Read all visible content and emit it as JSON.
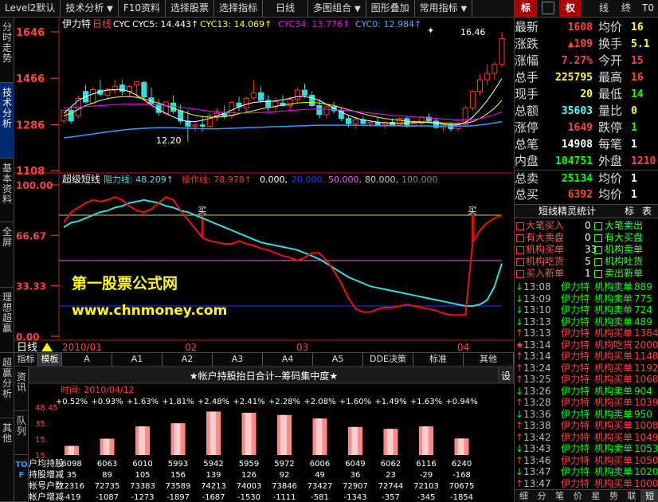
{
  "topbar": {
    "menu": [
      "Level2默认",
      "技术分析",
      "F10资料",
      "选择股票",
      "选择指标",
      "日线",
      "多图组合",
      "图形叠加",
      "常用指标"
    ]
  },
  "side_tabs": [
    "分时走势",
    "技术分析",
    "基本资料",
    "全屏",
    "理想超赢",
    "超赢分析",
    "资讯",
    "队列",
    "其他"
  ],
  "chart": {
    "stock": "伊力特",
    "period": "日线",
    "ind": "CYC",
    "legend": [
      {
        "label": "CYC5: 14.443↑",
        "color": "#ffffff"
      },
      {
        "label": "CYC13: 14.069↑",
        "color": "#ffff00"
      },
      {
        "label": "CYC34: 13.776↑",
        "color": "#ff00ff"
      },
      {
        "label": "CYC0: 12.984↑",
        "color": "#55aaff"
      }
    ],
    "price_ticks": [
      "1646",
      "1466",
      "1286",
      "1108"
    ],
    "price_ticks_val": [
      16.46,
      14.66,
      12.86,
      11.08
    ],
    "high_label": "16.46",
    "low_label": "12.20",
    "sub": {
      "name": "超级短线",
      "legend": [
        {
          "label": "阻力线: 48.209↑",
          "color": "#55dddd"
        },
        {
          "label": "操作线: 78.978↑",
          "color": "#ff3333"
        },
        {
          "label": "0.000,",
          "color": "#ffffff"
        },
        {
          "label": "20.000,",
          "color": "#3333ff"
        },
        {
          "label": "50.000,",
          "color": "#ff55ff"
        },
        {
          "label": "80.000,",
          "color": "#cccccc"
        },
        {
          "label": "100.000",
          "color": "#888888"
        }
      ],
      "ticks": [
        "100.00",
        "66.67",
        "33.33",
        "0.00"
      ],
      "ticks_val": [
        100,
        66.67,
        33.33,
        0
      ],
      "buy": "买"
    },
    "period_label": "日线",
    "dates": [
      "2010/01",
      "02",
      "03",
      "04"
    ],
    "watermark1": "第一股票公式网",
    "watermark2": "www.chnmoney.com",
    "candles": [
      [
        13.0,
        13.42,
        12.94,
        13.42
      ],
      [
        13.42,
        13.55,
        12.9,
        13.0
      ],
      [
        13.2,
        14.0,
        13.1,
        13.88
      ],
      [
        14.15,
        14.4,
        13.7,
        13.74
      ],
      [
        13.7,
        14.3,
        13.66,
        14.22
      ],
      [
        14.2,
        14.6,
        13.95,
        14.04
      ],
      [
        14.0,
        14.3,
        13.85,
        14.23
      ],
      [
        14.2,
        14.6,
        14.05,
        14.35
      ],
      [
        14.4,
        14.6,
        14.0,
        14.15
      ],
      [
        14.15,
        14.4,
        13.9,
        14.34
      ],
      [
        14.4,
        14.55,
        13.9,
        14.52
      ],
      [
        14.5,
        14.55,
        13.8,
        13.93
      ],
      [
        13.9,
        14.3,
        13.6,
        13.68
      ],
      [
        13.65,
        13.85,
        13.2,
        13.33
      ],
      [
        13.3,
        13.75,
        13.2,
        13.74
      ],
      [
        13.7,
        14.0,
        13.3,
        13.38
      ],
      [
        13.4,
        13.65,
        12.9,
        13.0
      ],
      [
        13.0,
        13.4,
        12.2,
        12.8
      ],
      [
        12.8,
        13.0,
        12.6,
        12.85
      ],
      [
        12.85,
        13.2,
        12.6,
        12.8
      ],
      [
        12.8,
        13.3,
        12.75,
        13.2
      ],
      [
        13.2,
        13.5,
        13.0,
        13.3
      ],
      [
        13.3,
        13.6,
        13.1,
        13.17
      ],
      [
        13.2,
        13.8,
        13.1,
        13.72
      ],
      [
        13.7,
        13.95,
        13.4,
        13.55
      ],
      [
        13.5,
        13.95,
        13.3,
        13.88
      ],
      [
        13.9,
        14.6,
        13.8,
        14.1
      ],
      [
        14.1,
        14.35,
        13.7,
        13.8
      ],
      [
        13.8,
        14.0,
        13.4,
        13.55
      ],
      [
        13.55,
        13.9,
        13.3,
        13.75
      ],
      [
        13.7,
        14.0,
        13.55,
        13.6
      ],
      [
        13.6,
        13.95,
        13.4,
        13.85
      ],
      [
        13.85,
        14.3,
        13.7,
        14.2
      ],
      [
        14.2,
        14.45,
        13.9,
        14.0
      ],
      [
        14.0,
        14.15,
        13.55,
        13.6
      ],
      [
        13.6,
        13.85,
        13.1,
        13.25
      ],
      [
        13.25,
        13.65,
        13.1,
        13.55
      ],
      [
        13.55,
        13.75,
        13.3,
        13.4
      ],
      [
        13.4,
        13.5,
        13.0,
        13.1
      ],
      [
        13.1,
        13.2,
        12.75,
        12.9
      ],
      [
        12.9,
        13.15,
        12.7,
        13.05
      ],
      [
        13.05,
        13.2,
        12.85,
        12.9
      ],
      [
        12.9,
        13.05,
        12.75,
        12.95
      ],
      [
        12.95,
        13.15,
        12.8,
        12.85
      ],
      [
        12.85,
        13.0,
        12.7,
        12.95
      ],
      [
        12.95,
        13.1,
        12.8,
        12.85
      ],
      [
        12.85,
        13.15,
        12.8,
        13.1
      ],
      [
        13.1,
        13.2,
        12.75,
        12.8
      ],
      [
        12.8,
        13.05,
        12.75,
        12.9
      ],
      [
        12.9,
        13.2,
        12.8,
        13.15
      ],
      [
        13.15,
        13.3,
        12.9,
        13.0
      ],
      [
        13.0,
        13.1,
        12.7,
        12.75
      ],
      [
        12.75,
        12.9,
        12.6,
        12.85
      ],
      [
        12.85,
        12.95,
        12.6,
        12.7
      ],
      [
        12.7,
        12.95,
        12.6,
        12.9
      ],
      [
        12.85,
        13.6,
        12.8,
        13.5
      ],
      [
        13.5,
        14.2,
        13.4,
        14.15
      ],
      [
        14.15,
        14.8,
        14.0,
        14.6
      ],
      [
        14.6,
        15.2,
        14.4,
        14.85
      ],
      [
        14.85,
        15.3,
        14.6,
        15.2
      ],
      [
        15.2,
        16.46,
        15.1,
        16.2
      ]
    ],
    "ma": {
      "cyc5": [
        13.3,
        13.55,
        13.8,
        13.95,
        14.05,
        14.15,
        14.2,
        14.22,
        14.22,
        14.15,
        14.0,
        13.82,
        13.62,
        13.45,
        13.3,
        13.16,
        13.05,
        12.98,
        12.98,
        13.03,
        13.1,
        13.2,
        13.3,
        13.42,
        13.55,
        13.65,
        13.72,
        13.75,
        13.76,
        13.78,
        13.82,
        13.88,
        13.95,
        13.95,
        13.9,
        13.8,
        13.65,
        13.5,
        13.35,
        13.22,
        13.12,
        13.05,
        13.0,
        12.96,
        12.93,
        12.92,
        12.92,
        12.93,
        12.94,
        12.95,
        12.94,
        12.92,
        12.88,
        12.85,
        12.85,
        12.95,
        13.15,
        13.45,
        13.8,
        14.2,
        14.65
      ],
      "cyc13": [
        13.2,
        13.3,
        13.45,
        13.6,
        13.7,
        13.8,
        13.87,
        13.92,
        13.95,
        13.95,
        13.92,
        13.86,
        13.78,
        13.7,
        13.6,
        13.5,
        13.4,
        13.3,
        13.22,
        13.17,
        13.15,
        13.15,
        13.18,
        13.22,
        13.28,
        13.34,
        13.4,
        13.47,
        13.52,
        13.57,
        13.62,
        13.66,
        13.7,
        13.72,
        13.72,
        13.7,
        13.65,
        13.6,
        13.52,
        13.44,
        13.36,
        13.28,
        13.21,
        13.15,
        13.1,
        13.06,
        13.03,
        13.0,
        12.98,
        12.97,
        12.96,
        12.95,
        12.93,
        12.92,
        12.9,
        12.92,
        12.98,
        13.1,
        13.28,
        13.5,
        13.8
      ],
      "cyc34": [
        13.5,
        13.52,
        13.54,
        13.56,
        13.58,
        13.6,
        13.62,
        13.64,
        13.65,
        13.66,
        13.66,
        13.66,
        13.65,
        13.63,
        13.6,
        13.57,
        13.54,
        13.5,
        13.46,
        13.42,
        13.38,
        13.35,
        13.33,
        13.32,
        13.31,
        13.31,
        13.32,
        13.33,
        13.35,
        13.37,
        13.39,
        13.41,
        13.43,
        13.45,
        13.46,
        13.46,
        13.45,
        13.44,
        13.42,
        13.4,
        13.37,
        13.34,
        13.31,
        13.28,
        13.25,
        13.22,
        13.2,
        13.18,
        13.16,
        13.14,
        13.12,
        13.1,
        13.08,
        13.06,
        13.04,
        13.04,
        13.06,
        13.1,
        13.16,
        13.25,
        13.35
      ],
      "cyc0": [
        12.35,
        12.38,
        12.42,
        12.46,
        12.5,
        12.54,
        12.58,
        12.62,
        12.65,
        12.68,
        12.7,
        12.72,
        12.73,
        12.74,
        12.74,
        12.74,
        12.73,
        12.72,
        12.71,
        12.7,
        12.7,
        12.7,
        12.71,
        12.72,
        12.73,
        12.74,
        12.75,
        12.76,
        12.77,
        12.78,
        12.79,
        12.8,
        12.81,
        12.82,
        12.83,
        12.84,
        12.84,
        12.84,
        12.84,
        12.84,
        12.84,
        12.83,
        12.83,
        12.82,
        12.82,
        12.82,
        12.82,
        12.81,
        12.81,
        12.81,
        12.81,
        12.8,
        12.8,
        12.8,
        12.8,
        12.8,
        12.82,
        12.85,
        12.88,
        12.93,
        12.98
      ]
    },
    "op": [
      75,
      82,
      85,
      88,
      90,
      89,
      90,
      92,
      90,
      86,
      83,
      82,
      84,
      88,
      92,
      90,
      83,
      77,
      71,
      65,
      63,
      62,
      61,
      61,
      63,
      61,
      60,
      58,
      57,
      55,
      53,
      52,
      50,
      52,
      55,
      55,
      50,
      43,
      35,
      25,
      18,
      16,
      16,
      18,
      19,
      19,
      20,
      21,
      20,
      19,
      18,
      17,
      15,
      14,
      14,
      14,
      62,
      70,
      75,
      78,
      80
    ],
    "resist": [
      72,
      75,
      76,
      78,
      80,
      82,
      83,
      85,
      86,
      88,
      89,
      90,
      89,
      88,
      86,
      85,
      83,
      82,
      80,
      78,
      76,
      74,
      72,
      70,
      68,
      66,
      64,
      62,
      61,
      60,
      59,
      58,
      57,
      55,
      53,
      51,
      48,
      45,
      42,
      39,
      37,
      35,
      33,
      32,
      31,
      30,
      29,
      28,
      27,
      26,
      25,
      24,
      23,
      22,
      21,
      20,
      20,
      21,
      24,
      33,
      48
    ],
    "buy_idx": [
      19,
      56
    ]
  },
  "indicator_tabs": [
    "指标",
    "模板",
    "A",
    "A1",
    "A2",
    "A3",
    "A4",
    "A5",
    "DDE决策",
    "标准",
    "其他"
  ],
  "bottom": {
    "title": "★帐户持股抬日合计--筹码集中度★",
    "gear": "设",
    "date": "时间: 2010/04/12",
    "ticks": [
      "48.45",
      "35.",
      "15.",
      "15."
    ],
    "pct": [
      "+0.52%",
      "+0.93%",
      "+1.63%",
      "+1.81%",
      "+2.48%",
      "+2.41%",
      "+2.28%",
      "+2.08%",
      "+1.60%",
      "+1.49%",
      "+1.63%",
      "+0.94%"
    ],
    "pct_val": [
      0.52,
      0.93,
      1.63,
      1.81,
      2.48,
      2.41,
      2.28,
      2.08,
      1.6,
      1.49,
      1.63,
      0.94
    ],
    "rows": [
      {
        "label": "户均持股",
        "values": [
          "6098",
          "6063",
          "6010",
          "5993",
          "5942",
          "5959",
          "5972",
          "6006",
          "6049",
          "6062",
          "6116",
          "6240"
        ]
      },
      {
        "label": "持股增减",
        "values": [
          "35",
          "89",
          "105",
          "156",
          "139",
          "126",
          "92",
          "49",
          "36",
          "23",
          "-29",
          "-168"
        ]
      },
      {
        "label": "帐号户数",
        "values": [
          "72316",
          "72735",
          "73383",
          "73589",
          "74213",
          "74003",
          "73846",
          "73427",
          "72907",
          "72744",
          "72103",
          "70675"
        ]
      },
      {
        "label": "帐户增减",
        "values": [
          "-419",
          "-1087",
          "-1273",
          "-1897",
          "-1687",
          "-1530",
          "-1111",
          "-581",
          "-1343",
          "-357",
          "-345",
          "-1854"
        ]
      }
    ],
    "tof": "TOF"
  },
  "right": {
    "tabs": [
      "标",
      "权",
      "线",
      "终",
      "T0"
    ],
    "active_tab": "权",
    "quotes": [
      {
        "l1": "最新",
        "v1": "1608",
        "c1": "#ff4040",
        "l2": "均价",
        "v2": "16",
        "c2": "#ffff00"
      },
      {
        "l1": "涨跌",
        "v1": "▲109",
        "c1": "#ff4040",
        "l2": "换手",
        "v2": "5.1",
        "c2": "#ffff00"
      },
      {
        "l1": "涨幅",
        "v1": "7.27%",
        "c1": "#ff4040",
        "l2": "今开",
        "v2": "15",
        "c2": "#ff4040"
      },
      {
        "l1": "总手",
        "v1": "225795",
        "c1": "#ffff00",
        "l2": "最高",
        "v2": "16",
        "c2": "#ff4040"
      },
      {
        "l1": "现手",
        "v1": "20",
        "c1": "#ffff00",
        "l2": "最低",
        "v2": "14",
        "c2": "#00ff00"
      },
      {
        "l1": "总额",
        "v1": "35603",
        "c1": "#55ffff",
        "l2": "量比",
        "v2": "0",
        "c2": "#ffff00"
      },
      {
        "l1": "涨停",
        "v1": "1649",
        "c1": "#ff4040",
        "l2": "跌停",
        "v2": "1",
        "c2": "#00ff00"
      },
      {
        "l1": "总笔",
        "v1": "14908",
        "c1": "#ffffff",
        "l2": "每笔",
        "v2": "1",
        "c2": "#ffffff"
      },
      {
        "l1": "内盘",
        "v1": "104751",
        "c1": "#00ff00",
        "l2": "外盘",
        "v2": "1210",
        "c2": "#ff4040"
      },
      {
        "l1": "总卖",
        "v1": "25134",
        "c1": "#00ff00",
        "l2": "均价",
        "v2": "1",
        "c2": "#ffffff"
      },
      {
        "l1": "总买",
        "v1": "6392",
        "c1": "#ff4040",
        "l2": "均价",
        "v2": "1",
        "c2": "#ffffff"
      }
    ],
    "elf_title": "短线精灵统计",
    "elf_tabs": [
      "标",
      "表"
    ],
    "elf": [
      {
        "l1": "大笔买入",
        "v1": "0",
        "l2": "大笔卖出",
        "v2": ""
      },
      {
        "l1": "有大卖盘",
        "v1": "0",
        "l2": "有大买盘",
        "v2": ""
      },
      {
        "l1": "机构买单",
        "v1": "33",
        "l2": "机构卖单",
        "v2": ""
      },
      {
        "l1": "机构吃货",
        "v1": "5",
        "l2": "机构吐货",
        "v2": ""
      },
      {
        "l1": "买入新单",
        "v1": "1",
        "l2": "卖出新单",
        "v2": ""
      }
    ],
    "trades": [
      {
        "t": "13:08",
        "n": "伊力特",
        "a": "机构卖单",
        "v": "889",
        "s": "↓",
        "c": "#00ff00"
      },
      {
        "t": "13:09",
        "n": "伊力特",
        "a": "机构卖单",
        "v": "775",
        "s": "↓",
        "c": "#00ff00"
      },
      {
        "t": "13:10",
        "n": "伊力特",
        "a": "机构卖单",
        "v": "724",
        "s": "↓",
        "c": "#00ff00"
      },
      {
        "t": "13:13",
        "n": "伊力特",
        "a": "机构卖单",
        "v": "489",
        "s": "↓",
        "c": "#00ff00"
      },
      {
        "t": "13:13",
        "n": "伊力特",
        "a": "机构买单",
        "v": "1384",
        "s": "↑",
        "c": "#ff4040"
      },
      {
        "t": "13:14",
        "n": "伊力特",
        "a": "机构吃货",
        "v": "2000",
        "s": "★",
        "c": "#ff4040"
      },
      {
        "t": "13:14",
        "n": "伊力特",
        "a": "机构买单",
        "v": "1148",
        "s": "↑",
        "c": "#ff4040"
      },
      {
        "t": "13:24",
        "n": "伊力特",
        "a": "机构买单",
        "v": "1192",
        "s": "↑",
        "c": "#ff4040"
      },
      {
        "t": "13:25",
        "n": "伊力特",
        "a": "机构买单",
        "v": "1068",
        "s": "↑",
        "c": "#ff4040"
      },
      {
        "t": "13:26",
        "n": "伊力特",
        "a": "机构卖单",
        "v": "904",
        "s": "↓",
        "c": "#00ff00"
      },
      {
        "t": "13:28",
        "n": "伊力特",
        "a": "机构买单",
        "v": "1039",
        "s": "↑",
        "c": "#ff4040"
      },
      {
        "t": "13:36",
        "n": "伊力特",
        "a": "机构卖单",
        "v": "950",
        "s": "↓",
        "c": "#00ff00"
      },
      {
        "t": "13:38",
        "n": "伊力特",
        "a": "机构买单",
        "v": "1008",
        "s": "↑",
        "c": "#ff4040"
      },
      {
        "t": "13:42",
        "n": "伊力特",
        "a": "机构买单",
        "v": "1049",
        "s": "↑",
        "c": "#ff4040"
      },
      {
        "t": "13:43",
        "n": "伊力特",
        "a": "机构卖单",
        "v": "1053",
        "s": "↓",
        "c": "#00ff00"
      },
      {
        "t": "13:46",
        "n": "伊力特",
        "a": "机构买单",
        "v": "1050",
        "s": "↑",
        "c": "#ff4040"
      },
      {
        "t": "13:47",
        "n": "伊力特",
        "a": "机构卖单",
        "v": "1020",
        "s": "↓",
        "c": "#00ff00"
      },
      {
        "t": "13:47",
        "n": "伊力特",
        "a": "机构买单",
        "v": "1000",
        "s": "↑",
        "c": "#ff4040"
      }
    ],
    "bottom_tabs": [
      "细",
      "分",
      "笔",
      "价",
      "星",
      "势",
      "联",
      "短"
    ]
  }
}
